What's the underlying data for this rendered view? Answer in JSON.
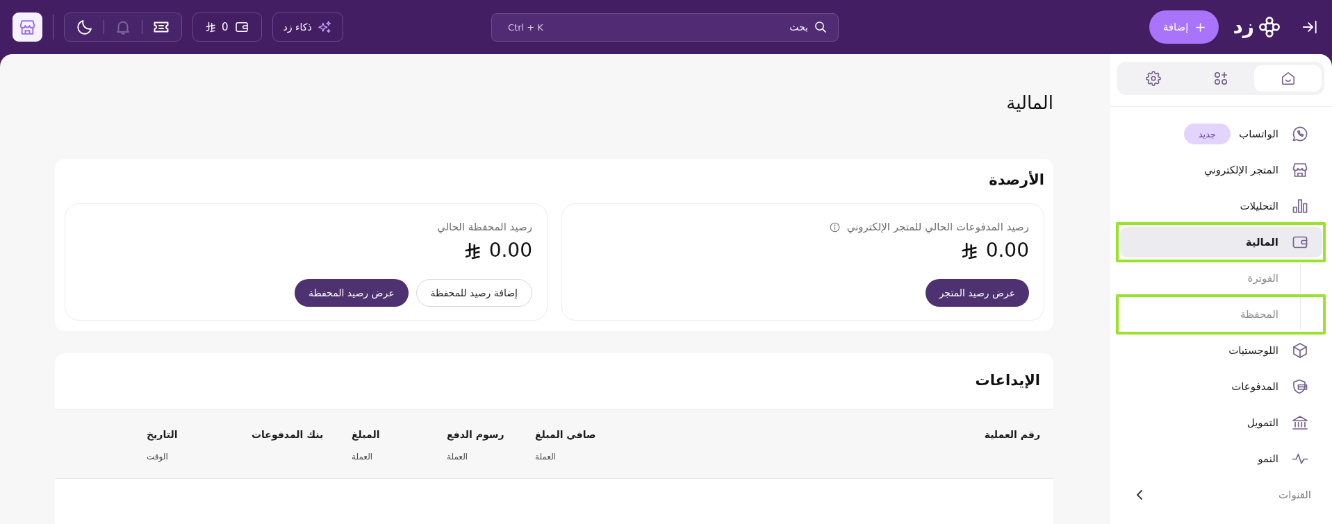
{
  "top_bar": {
    "brand": "زد",
    "add_button": "إضافة",
    "search": {
      "placeholder": "بحث",
      "shortcut": "Ctrl + K"
    },
    "ai_button": "ذكاء زد",
    "wallet": {
      "balance": "0"
    },
    "quick_actions": [
      {
        "kind": "ticket",
        "disabled": false
      },
      {
        "kind": "bell",
        "disabled": true
      },
      {
        "kind": "moon",
        "disabled": false
      }
    ]
  },
  "sidebar": {
    "tabs": [
      {
        "kind": "home",
        "selected": true
      },
      {
        "kind": "apps",
        "selected": false
      },
      {
        "kind": "settings",
        "selected": false
      }
    ],
    "items": [
      {
        "label": "الواتساب",
        "kind": "chat",
        "badge": "جديد",
        "selected": false,
        "highlighted": false
      },
      {
        "label": "المتجر الإلكتروني",
        "kind": "store",
        "selected": false,
        "highlighted": false
      },
      {
        "label": "التحليلات",
        "kind": "chart",
        "selected": false,
        "highlighted": false
      },
      {
        "label": "المالية",
        "kind": "wallet",
        "selected": true,
        "highlighted": true,
        "children": [
          {
            "label": "الفوترة",
            "selected": false,
            "highlighted": false
          },
          {
            "label": "المحفظة",
            "selected": false,
            "highlighted": true
          }
        ]
      },
      {
        "label": "اللوجستيات",
        "kind": "box",
        "selected": false,
        "highlighted": false
      },
      {
        "label": "المدفوعات",
        "kind": "payments",
        "selected": false,
        "highlighted": false
      },
      {
        "label": "التمويل",
        "kind": "bank",
        "selected": false,
        "highlighted": false
      },
      {
        "label": "النمو",
        "kind": "growth",
        "selected": false,
        "highlighted": false
      }
    ],
    "section": {
      "label": "القنوات",
      "expanded": false
    }
  },
  "page_title": "المالية",
  "balances": {
    "title": "الأرصدة",
    "cards": [
      {
        "label": "رصيد المدفوعات الحالي للمتجر الإلكتروني",
        "has_info": true,
        "amount": "0.00",
        "buttons": [
          {
            "label": "عرض رصيد المتجر",
            "kind": "primary"
          }
        ]
      },
      {
        "label": "رصيد المحفظة الحالي",
        "has_info": false,
        "amount": "0.00",
        "buttons": [
          {
            "label": "إضافة رصيد للمحفظة",
            "kind": "secondary"
          },
          {
            "label": "عرض رصيد المحفظة",
            "kind": "primary"
          }
        ]
      }
    ]
  },
  "deposits": {
    "title": "الإيداعات",
    "columns": [
      {
        "label": "رقم العملية"
      },
      {
        "label": "صافي المبلغ",
        "sublabel": "العملة"
      },
      {
        "label": "رسوم الدفع",
        "sublabel": "العملة"
      },
      {
        "label": "المبلغ",
        "sublabel": "العملة"
      },
      {
        "label": "بنك المدفوعات"
      },
      {
        "label": "التاريخ",
        "sublabel": "الوقت"
      }
    ]
  }
}
